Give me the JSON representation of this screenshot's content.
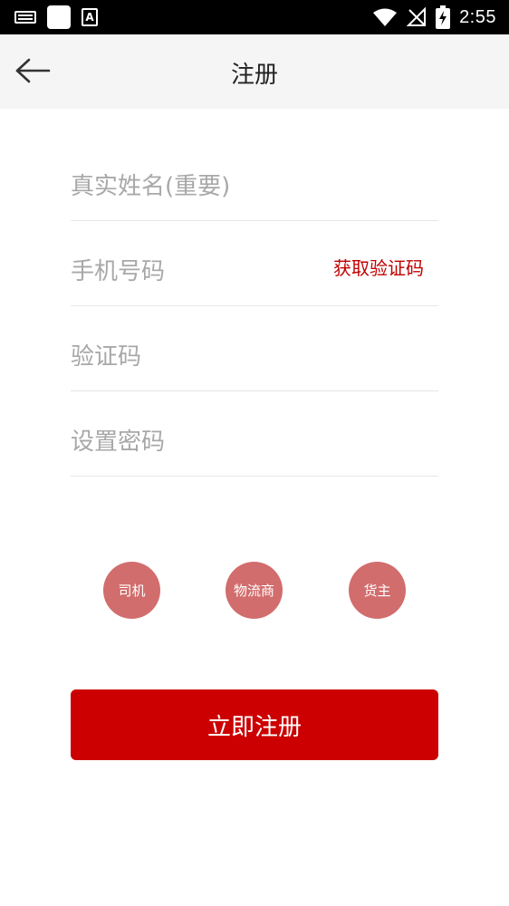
{
  "status_bar": {
    "time": "2:55",
    "icons": [
      "keyboard-icon",
      "app-square-icon",
      "a-text-icon",
      "wifi-icon",
      "no-signal-icon",
      "battery-charging-icon"
    ]
  },
  "header": {
    "title": "注册",
    "back_icon": "arrow-left-icon"
  },
  "form": {
    "name_placeholder": "真实姓名(重要)",
    "phone_placeholder": "手机号码",
    "get_code_label": "获取验证码",
    "code_placeholder": "验证码",
    "password_placeholder": "设置密码"
  },
  "roles": [
    {
      "label": "司机"
    },
    {
      "label": "物流商"
    },
    {
      "label": "货主"
    }
  ],
  "submit_label": "立即注册",
  "colors": {
    "primary": "#cc0000",
    "role_circle": "#d26d6d",
    "header_bg": "#f5f5f5",
    "placeholder": "#a8a8a8"
  }
}
